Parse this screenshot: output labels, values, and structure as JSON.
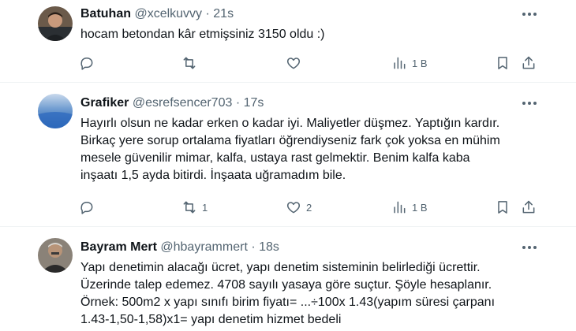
{
  "tweets": [
    {
      "name": "Batuhan",
      "handle": "@xcelkuvvy",
      "separator": "·",
      "time": "21s",
      "lines": [
        "hocam betondan kâr etmişsiniz 3150 oldu :)"
      ],
      "stats": {
        "reply": "",
        "retweet": "",
        "like": "",
        "views": "1 B"
      }
    },
    {
      "name": "Grafiker",
      "handle": "@esrefsencer703",
      "separator": "·",
      "time": "17s",
      "lines": [
        "Hayırlı olsun ne kadar erken o kadar iyi. Maliyetler düşmez. Yaptığın kardır.",
        "Birkaç yere sorup ortalama fiyatları öğrendiyseniz fark çok yoksa en mühim",
        "mesele güvenilir mimar, kalfa, ustaya rast gelmektir. Benim kalfa kaba",
        "inşaatı 1,5 ayda bitirdi. İnşaata uğramadım bile."
      ],
      "stats": {
        "reply": "",
        "retweet": "1",
        "like": "2",
        "views": "1 B"
      }
    },
    {
      "name": "Bayram Mert",
      "handle": "@hbayrammert",
      "separator": "·",
      "time": "18s",
      "lines": [
        "Yapı denetimin alacağı ücret, yapı denetim sisteminin belirlediği ücrettir.",
        "Üzerinde talep edemez. 4708 sayılı yasaya göre suçtur. Şöyle hesaplanır.",
        "Örnek: 500m2 x yapı sınıfı birim fiyatı= ...÷100x 1.43(yapım süresi çarpanı",
        "1.43-1,50-1,58)x1= yapı denetim hizmet bedeli"
      ]
    }
  ]
}
